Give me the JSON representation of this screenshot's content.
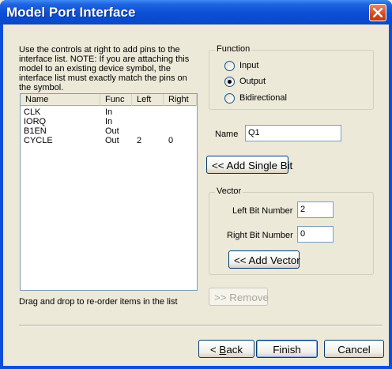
{
  "window": {
    "title": "Model Port Interface"
  },
  "instructions": "Use the controls at right to add pins to the interface list.  NOTE: If you are attaching this model to an existing device symbol, the interface list must exactly match the pins on the symbol.",
  "pin_list": {
    "columns": [
      "Name",
      "Func",
      "Left",
      "Right"
    ],
    "rows": [
      {
        "name": "CLK",
        "func": "In",
        "left": "",
        "right": ""
      },
      {
        "name": "IORQ",
        "func": "In",
        "left": "",
        "right": ""
      },
      {
        "name": "B1EN",
        "func": "Out",
        "left": "",
        "right": ""
      },
      {
        "name": "CYCLE",
        "func": "Out",
        "left": "2",
        "right": "0"
      }
    ]
  },
  "drag_hint": "Drag and drop to re-order items in the list",
  "function_group": {
    "label": "Function",
    "options": [
      "Input",
      "Output",
      "Bidirectional"
    ],
    "selected": "Output"
  },
  "name_field": {
    "label": "Name",
    "value": "Q1"
  },
  "add_single_bit_label": "<< Add Single Bit",
  "vector_group": {
    "label": "Vector",
    "left_bit_label": "Left Bit Number",
    "left_bit_value": "2",
    "right_bit_label": "Right Bit Number",
    "right_bit_value": "0",
    "add_vector_label": "<< Add Vector"
  },
  "remove_label": ">> Remove",
  "footer": {
    "back_prefix": "< ",
    "back_mnemonic": "B",
    "back_rest": "ack",
    "finish_label": "Finish",
    "cancel_label": "Cancel"
  }
}
